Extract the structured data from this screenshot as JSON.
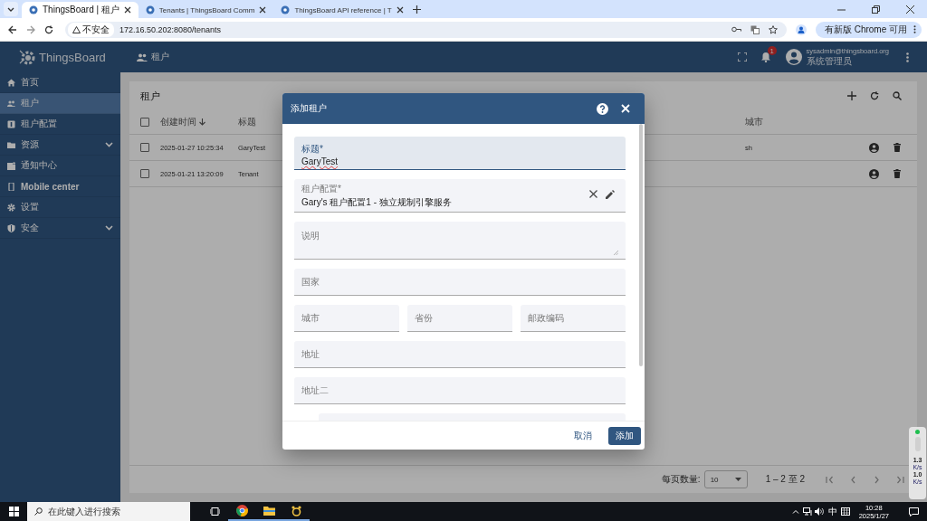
{
  "browser": {
    "tabs": [
      {
        "title": "ThingsBoard | 租户",
        "selected": true
      },
      {
        "title": "Tenants | ThingsBoard Comm",
        "selected": false
      },
      {
        "title": "ThingsBoard API reference | T",
        "selected": false
      }
    ],
    "security": "不安全",
    "url": "172.16.50.202:8080/tenants",
    "update_button": "有新版 Chrome 可用"
  },
  "app": {
    "brand": "ThingsBoard",
    "page_title": "租户",
    "notification_count": "1",
    "user_email": "sysadmin@thingsboard.org",
    "user_role": "系统管理员"
  },
  "sidebar": {
    "items": [
      {
        "label": "首页",
        "selected": false,
        "expandable": false
      },
      {
        "label": "租户",
        "selected": true,
        "expandable": false
      },
      {
        "label": "租户配置",
        "selected": false,
        "expandable": false
      },
      {
        "label": "资源",
        "selected": false,
        "expandable": true
      },
      {
        "label": "通知中心",
        "selected": false,
        "expandable": false
      },
      {
        "label": "Mobile center",
        "selected": false,
        "expandable": false
      },
      {
        "label": "设置",
        "selected": false,
        "expandable": false
      },
      {
        "label": "安全",
        "selected": false,
        "expandable": true
      }
    ]
  },
  "table": {
    "title": "租户",
    "all_checked": false,
    "columns": [
      {
        "label": "创建时间",
        "sorted": true
      },
      {
        "label": "标题",
        "sorted": false
      },
      {
        "label": "城市",
        "sorted": false
      }
    ],
    "rows": [
      {
        "created": "2025-01-27 10:25:34",
        "title": "GaryTest",
        "city": "sh",
        "checked": false
      },
      {
        "created": "2025-01-21 13:20:09",
        "title": "Tenant",
        "checked": false
      }
    ],
    "pagination": {
      "page_size_label": "每页数量:",
      "page_size": "10",
      "range": "1 – 2 至 2"
    }
  },
  "dialog": {
    "title": "添加租户",
    "rows": [
      [
        {
          "kind": "text",
          "label": "标题*",
          "value": "GaryTest",
          "focused": true
        }
      ],
      [
        {
          "kind": "select",
          "label": "租户配置*",
          "value": "Gary's 租户配置1 - 独立规制引擎服务",
          "focused": false
        }
      ],
      [
        {
          "kind": "textarea",
          "placeholder": "说明"
        }
      ],
      [
        {
          "kind": "text",
          "placeholder": "国家"
        }
      ],
      [
        {
          "kind": "text",
          "placeholder": "城市"
        },
        {
          "kind": "text",
          "placeholder": "省份"
        },
        {
          "kind": "text",
          "placeholder": "邮政编码"
        }
      ],
      [
        {
          "kind": "text",
          "placeholder": "地址"
        }
      ],
      [
        {
          "kind": "text",
          "placeholder": "地址二"
        }
      ],
      [
        {
          "kind": "phone"
        }
      ]
    ],
    "cancel": "取消",
    "submit": "添加"
  },
  "net_widget": {
    "readings": [
      {
        "value": "1.3",
        "unit": "K/s"
      },
      {
        "value": "1.0",
        "unit": "K/s"
      }
    ]
  },
  "taskbar": {
    "search_placeholder": "在此键入进行搜索",
    "ime": "中",
    "time": "10:28",
    "date": "2025/1/27"
  }
}
